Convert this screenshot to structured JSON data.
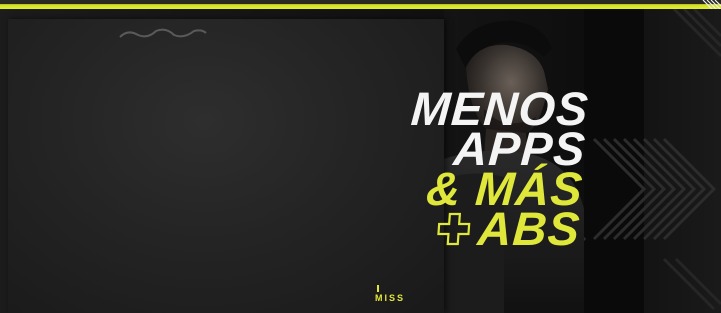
{
  "headline": {
    "line1": "MENOS",
    "line2": "APPS",
    "line3": "& MÁS",
    "line4": "ABS"
  },
  "brand": {
    "line1": "MISS"
  },
  "icons": {
    "plus": "plus-outline-icon"
  },
  "colors": {
    "accent": "#dfe83a",
    "text": "#f4f4f4",
    "background": "#161616"
  }
}
